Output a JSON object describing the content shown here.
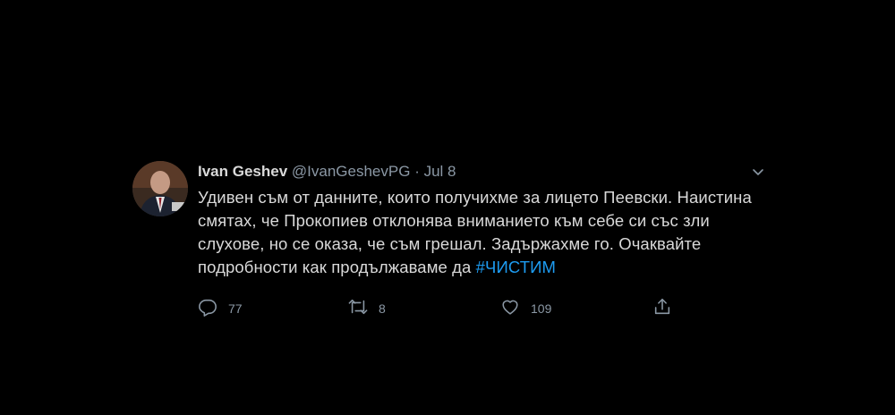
{
  "tweet": {
    "author_name": "Ivan Geshev",
    "handle": "@IvanGeshevPG",
    "separator": "·",
    "date": "Jul 8",
    "text_line1": "Удивен съм от данните, които получихме за лицето Пеевски. Наистина",
    "text_line2": "смятах, че Прокопиев отклонява вниманието към себе си със зли",
    "text_line3": "слухове, но се оказа, че съм грешал. Задържахме го. Очаквайте",
    "text_line4_prefix": "подробности как продължаваме да ",
    "hashtag": "#ЧИСТИМ"
  },
  "actions": {
    "replies": "77",
    "retweets": "8",
    "likes": "109"
  },
  "icons": {
    "avatar": "profile-photo",
    "menu": "chevron-down-icon",
    "reply": "reply-icon",
    "retweet": "retweet-icon",
    "like": "heart-icon",
    "share": "share-icon"
  },
  "colors": {
    "background": "#000000",
    "text": "#d9d9d9",
    "secondary": "#8b98a5",
    "accent": "#1d9bf0"
  }
}
